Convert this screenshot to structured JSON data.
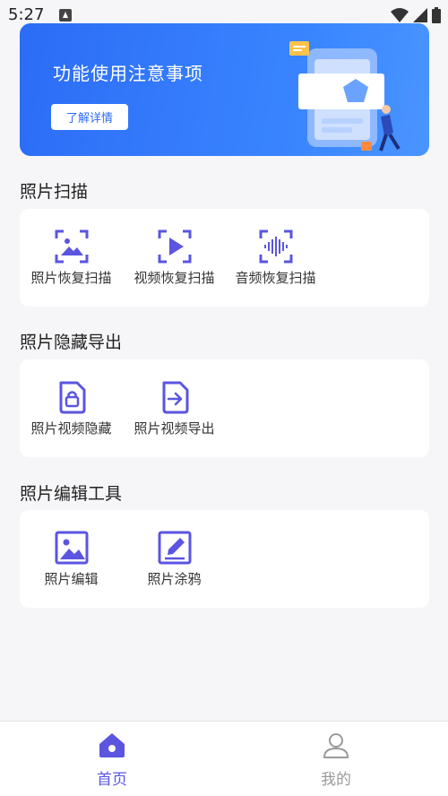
{
  "status_bar": {
    "time": "5:27"
  },
  "banner": {
    "title": "功能使用注意事项",
    "button_label": "了解详情"
  },
  "sections": [
    {
      "title": "照片扫描",
      "items": [
        {
          "label": "照片恢复扫描",
          "icon": "photo-scan-icon"
        },
        {
          "label": "视频恢复扫描",
          "icon": "video-scan-icon"
        },
        {
          "label": "音频恢复扫描",
          "icon": "audio-scan-icon"
        }
      ]
    },
    {
      "title": "照片隐藏导出",
      "items": [
        {
          "label": "照片视频隐藏",
          "icon": "lock-file-icon"
        },
        {
          "label": "照片视频导出",
          "icon": "export-file-icon"
        }
      ]
    },
    {
      "title": "照片编辑工具",
      "items": [
        {
          "label": "照片编辑",
          "icon": "image-icon"
        },
        {
          "label": "照片涂鸦",
          "icon": "pencil-square-icon"
        }
      ]
    }
  ],
  "bottom_nav": [
    {
      "label": "首页",
      "icon": "home-icon",
      "active": true
    },
    {
      "label": "我的",
      "icon": "person-icon",
      "active": false
    }
  ],
  "colors": {
    "accent": "#5b55e0",
    "banner_blue": "#2c6cf6",
    "inactive": "#9a9a9a"
  }
}
